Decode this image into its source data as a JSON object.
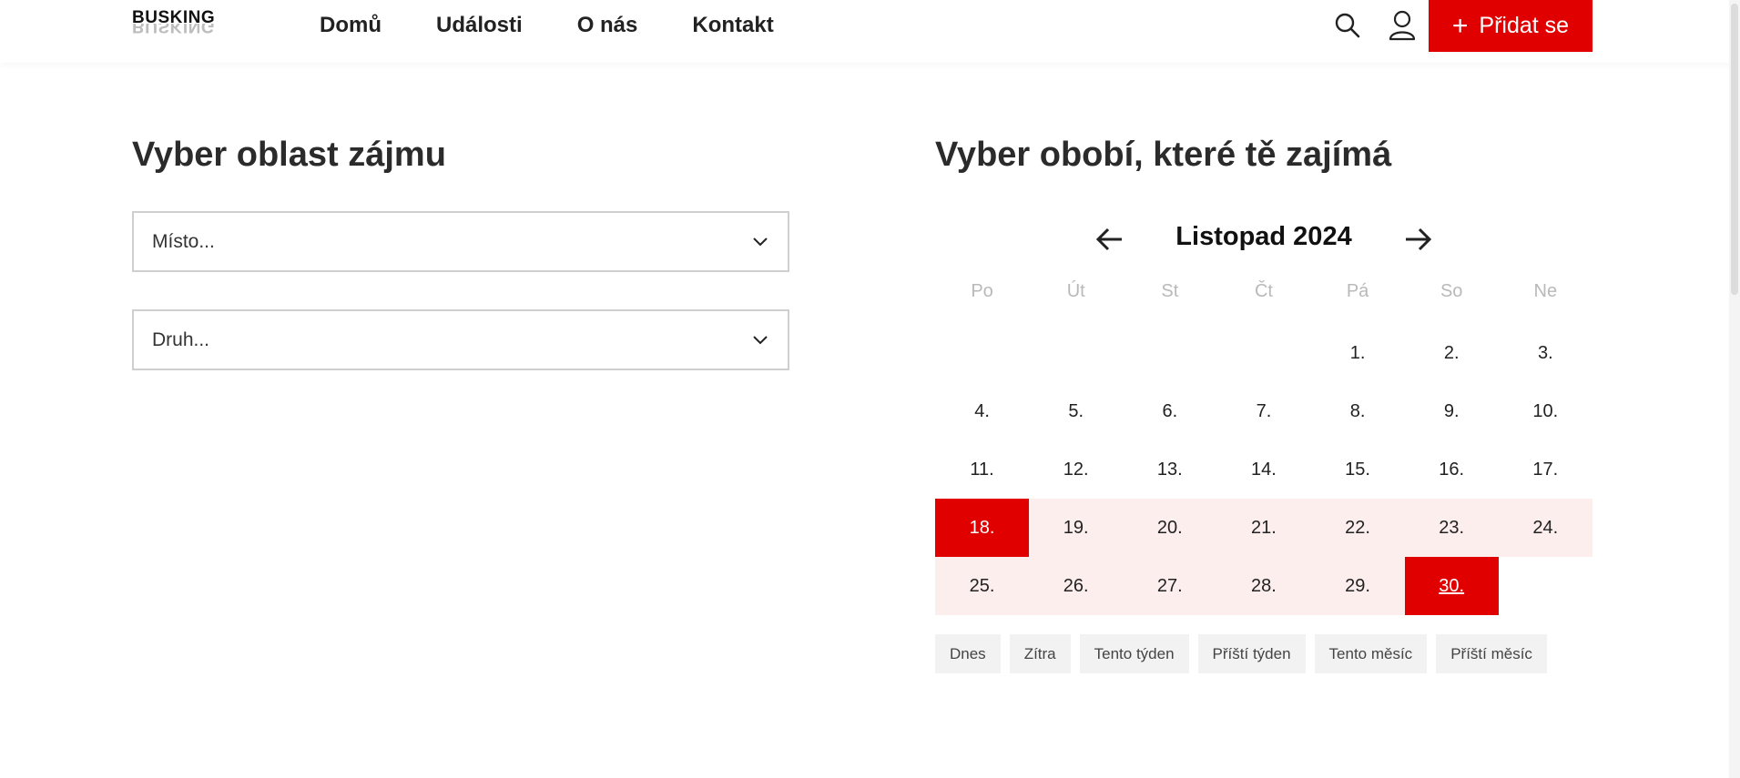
{
  "header": {
    "logo": "BUSKING",
    "nav": [
      "Domů",
      "Události",
      "O nás",
      "Kontakt"
    ],
    "add_button": "Přidat se",
    "icons": {
      "search": "search-icon",
      "user": "user-icon",
      "plus": "plus-icon"
    }
  },
  "filters": {
    "title": "Vyber oblast zájmu",
    "place_placeholder": "Místo...",
    "type_placeholder": "Druh..."
  },
  "calendar": {
    "title": "Vyber obobí, které tě zajímá",
    "month": "Listopad 2024",
    "weekdays": [
      "Po",
      "Út",
      "St",
      "Čt",
      "Pá",
      "So",
      "Ne"
    ],
    "weeks": [
      [
        "",
        "",
        "",
        "",
        "1.",
        "2.",
        "3."
      ],
      [
        "4.",
        "5.",
        "6.",
        "7.",
        "8.",
        "9.",
        "10."
      ],
      [
        "11.",
        "12.",
        "13.",
        "14.",
        "15.",
        "16.",
        "17."
      ],
      [
        "18.",
        "19.",
        "20.",
        "21.",
        "22.",
        "23.",
        "24."
      ],
      [
        "25.",
        "26.",
        "27.",
        "28.",
        "29.",
        "30.",
        ""
      ]
    ],
    "range_start": "18.",
    "range_end": "30.",
    "quick_ranges": [
      "Dnes",
      "Zítra",
      "Tento týden",
      "Příští týden",
      "Tento měsíc",
      "Příští měsíc"
    ]
  },
  "colors": {
    "accent": "#e10000",
    "range_bg": "#fdeeee",
    "chip_bg": "#f2f2f2",
    "weekday_text": "#b9b9b9"
  }
}
